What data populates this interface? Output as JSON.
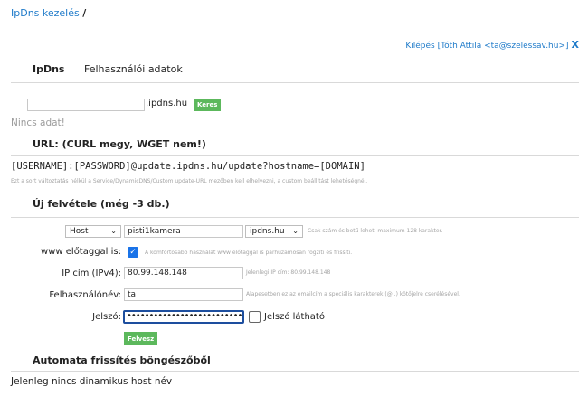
{
  "breadcrumb": {
    "link": "IpDns kezelés",
    "sep": "/"
  },
  "logout": {
    "text": "Kilépés [Tóth Attila <ta@szelessav.hu>]",
    "close": "X"
  },
  "tabs": [
    {
      "label": "IpDns"
    },
    {
      "label": "Felhasználói adatok"
    }
  ],
  "search": {
    "value": "",
    "suffix": ".ipdns.hu",
    "button": "Keres",
    "empty": "Nincs adat!"
  },
  "url_section": {
    "title": "URL: (CURL megy, WGET nem!)",
    "template": "[USERNAME]:[PASSWORD]@update.ipdns.hu/update?hostname=[DOMAIN]",
    "hint": "Ezt a sort változtatás nélkül a Service/DynamicDNS/Custom update-URL mezőben kell elhelyezni, a custom beállítást lehetőségnél."
  },
  "new_record": {
    "title": "Új felvétele (még -3 db.)",
    "type_select": "Host",
    "host_value": "pisti1kamera",
    "domain_select": "ipdns.hu",
    "host_hint": "Csak szám és betű lehet, maximum 128 karakter.",
    "www_label": "www előtaggal is:",
    "www_checked": true,
    "www_hint": "A komfortosabb használat www előtaggal is párhuzamosan rögzíti és frissíti.",
    "ip_label": "IP cím (IPv4):",
    "ip_value": "80.99.148.148",
    "ip_hint": "Jelenlegi IP cím: 80.99.148.148",
    "user_label": "Felhasználónév:",
    "user_value": "ta",
    "user_hint": "Alapesetben ez az emailcím a speciális karakterek (@ .) kötőjelre cserélésével.",
    "pw_label": "Jelszó:",
    "pw_value": "••••••••••••••••••••••••••",
    "show_pw_label": "Jelszó látható",
    "submit": "Felvesz"
  },
  "auto": {
    "title": "Automata frissítés böngészőből",
    "text": "Jelenleg nincs dinamikus host név"
  }
}
